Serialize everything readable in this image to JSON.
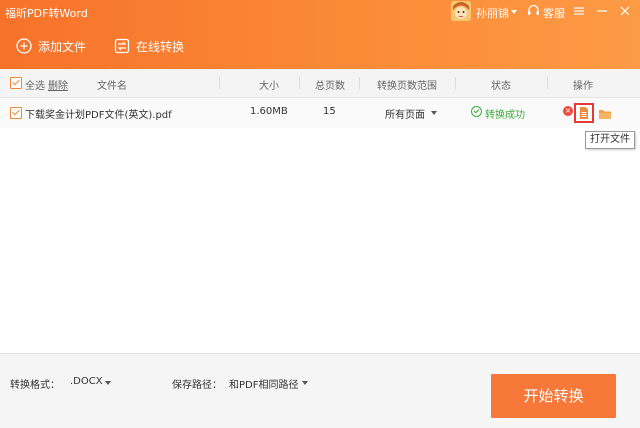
{
  "app": {
    "title": "福昕PDF转Word",
    "username": "孙丽锦",
    "support_label": "客服"
  },
  "toolbar": {
    "add_file_label": "添加文件",
    "online_convert_label": "在线转换"
  },
  "columns": {
    "select_all": "全选",
    "delete": "删除",
    "filename": "文件名",
    "size": "大小",
    "pages": "总页数",
    "page_range": "转换页数范围",
    "status": "状态",
    "actions": "操作"
  },
  "files": [
    {
      "name": "下载奖金计划PDF文件(英文).pdf",
      "size": "1.60MB",
      "pages": "15",
      "page_range": "所有页面",
      "status": "转换成功"
    }
  ],
  "tooltip": "打开文件",
  "footer": {
    "format_label": "转换格式：",
    "format_value": ".DOCX",
    "path_label": "保存路径：",
    "path_value": "和PDF相同路径",
    "start_label": "开始转换"
  },
  "colors": {
    "brand": "#f8783a",
    "success": "#3aae3a",
    "highlight": "#e53935"
  }
}
